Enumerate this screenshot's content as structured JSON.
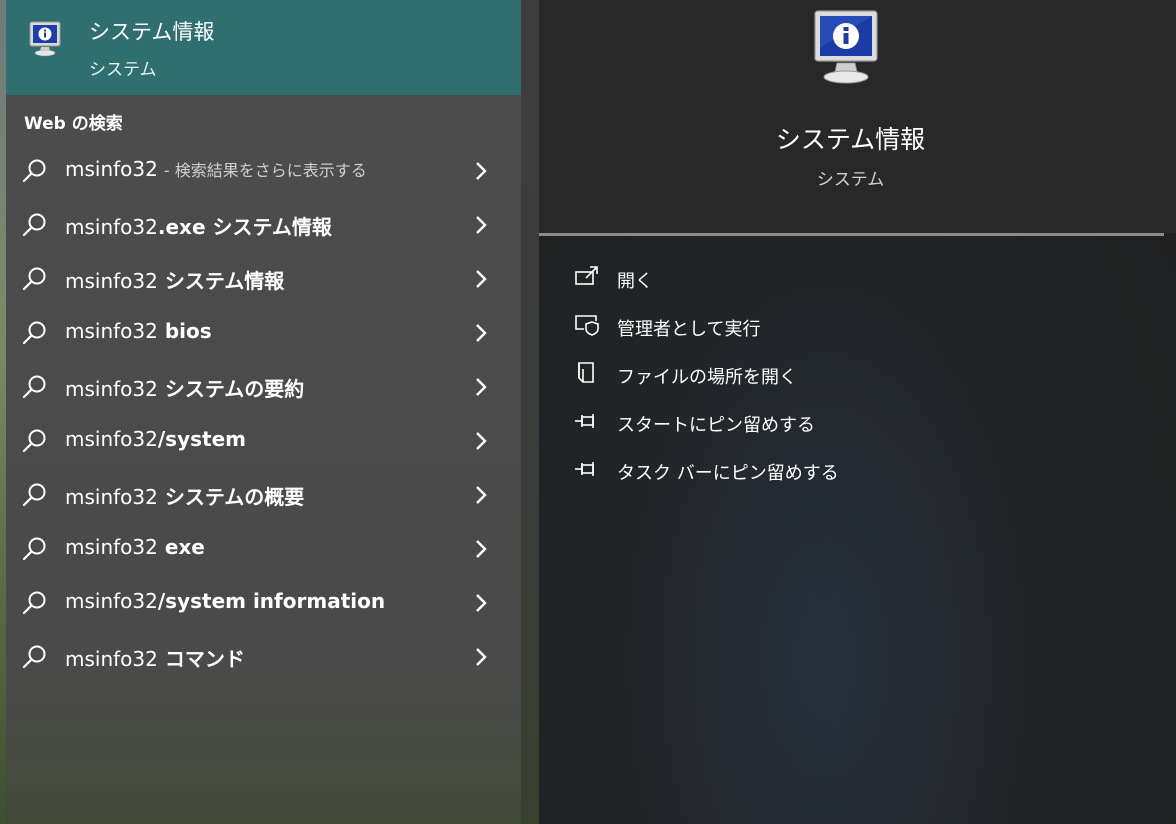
{
  "best_match": {
    "title": "システム情報",
    "subtitle": "システム",
    "icon": "system-information-icon"
  },
  "web_section": {
    "header": "Web の検索",
    "items": [
      {
        "query": "msinfo32",
        "suffix": "",
        "hint": "- 検索結果をさらに表示する"
      },
      {
        "query": "msinfo32",
        "suffix": ".exe システム情報",
        "hint": ""
      },
      {
        "query": "msinfo32",
        "suffix": " システム情報",
        "hint": ""
      },
      {
        "query": "msinfo32",
        "suffix": " bios",
        "hint": ""
      },
      {
        "query": "msinfo32",
        "suffix": " システムの要約",
        "hint": ""
      },
      {
        "query": "msinfo32",
        "suffix": "/system",
        "hint": ""
      },
      {
        "query": "msinfo32",
        "suffix": " システムの概要",
        "hint": ""
      },
      {
        "query": "msinfo32",
        "suffix": " exe",
        "hint": ""
      },
      {
        "query": "msinfo32",
        "suffix": "/system information",
        "hint": ""
      },
      {
        "query": "msinfo32",
        "suffix": " コマンド",
        "hint": ""
      }
    ]
  },
  "preview": {
    "title": "システム情報",
    "subtitle": "システム",
    "actions": [
      {
        "label": "開く",
        "icon": "open-icon"
      },
      {
        "label": "管理者として実行",
        "icon": "run-as-admin-icon"
      },
      {
        "label": "ファイルの場所を開く",
        "icon": "open-file-location-icon"
      },
      {
        "label": "スタートにピン留めする",
        "icon": "pin-to-start-icon"
      },
      {
        "label": "タスク バーにピン留めする",
        "icon": "pin-to-taskbar-icon"
      }
    ]
  },
  "colors": {
    "selected_bg": "#2f6f6f",
    "left_bg": "#4a4a4a",
    "right_bg": "#222222",
    "separator": "#8c8c8c"
  }
}
